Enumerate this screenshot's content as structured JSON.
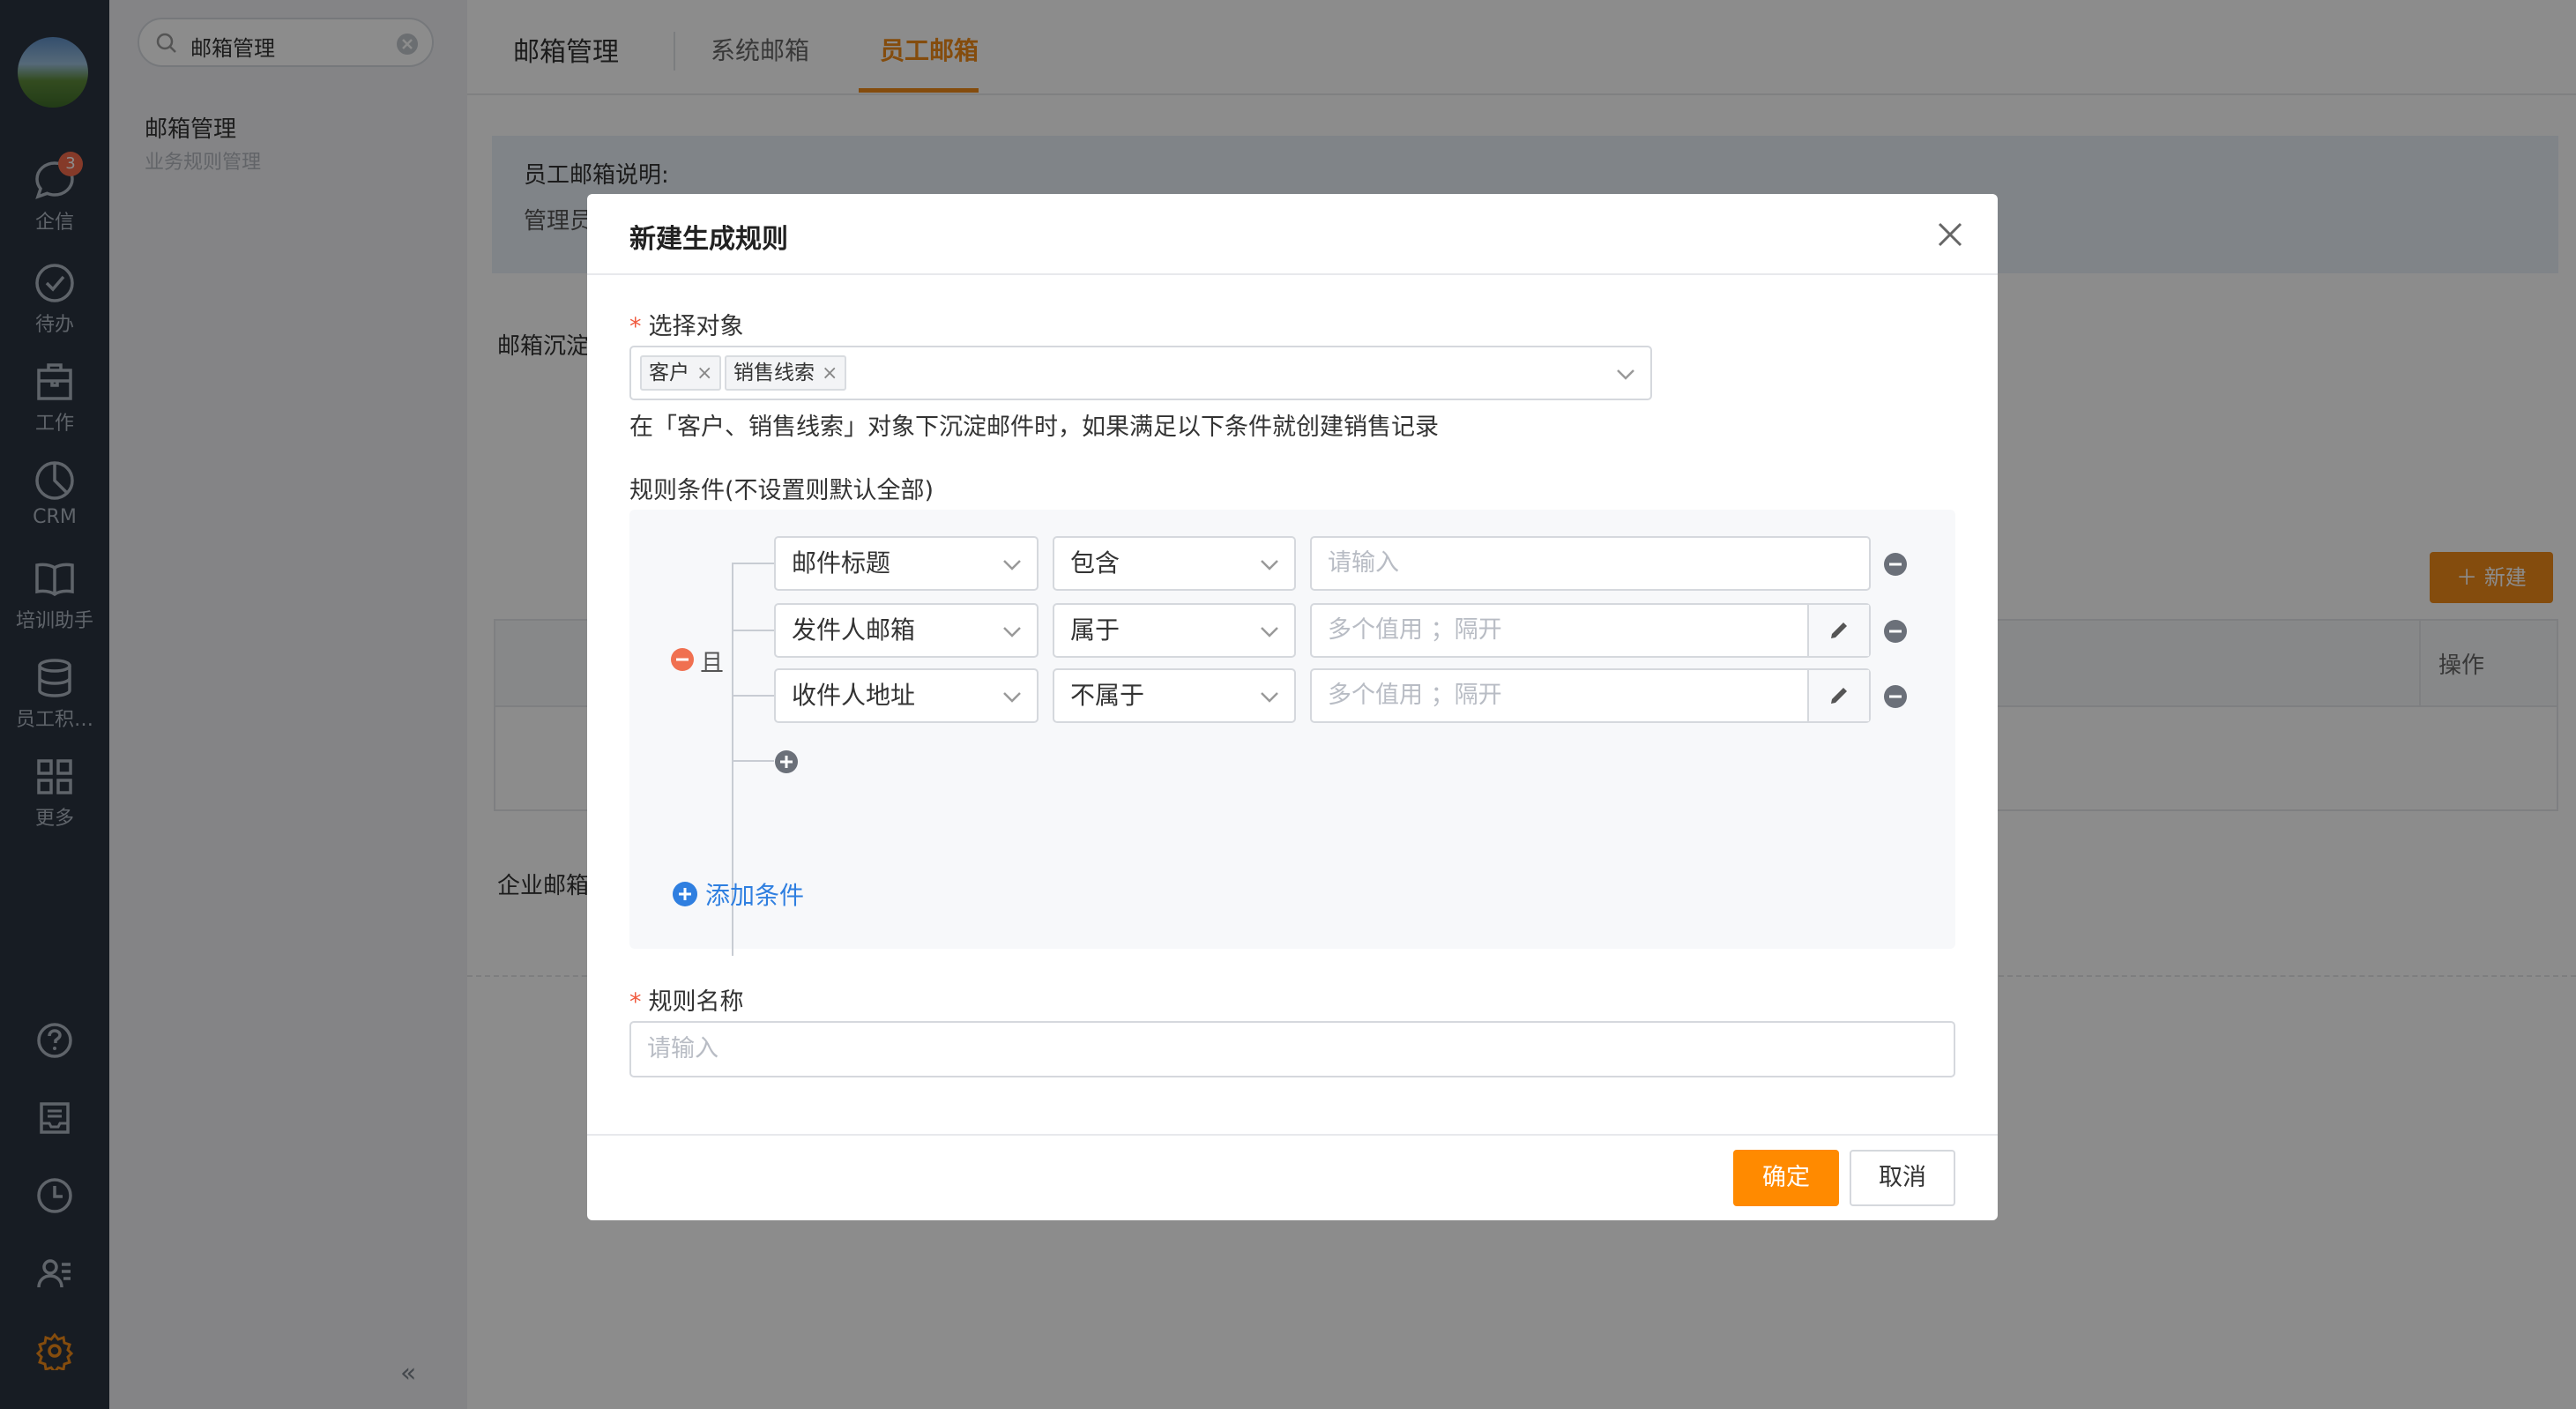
{
  "rail": {
    "items": [
      {
        "label": "企信",
        "icon": "chat-bubble-icon",
        "badge": "3"
      },
      {
        "label": "待办",
        "icon": "check-circle-icon"
      },
      {
        "label": "工作",
        "icon": "briefcase-icon"
      },
      {
        "label": "CRM",
        "icon": "pie-chart-icon"
      },
      {
        "label": "培训助手",
        "icon": "book-icon"
      },
      {
        "label": "员工积…",
        "icon": "database-icon"
      },
      {
        "label": "更多",
        "icon": "grid-icon"
      }
    ],
    "bottom_icons": [
      "help-icon",
      "inbox-icon",
      "clock-icon",
      "contacts-icon",
      "settings-gear-icon"
    ]
  },
  "sidebar": {
    "search_value": "邮箱管理",
    "item_title": "邮箱管理",
    "item_subtitle": "业务规则管理",
    "collapse_glyph": "«"
  },
  "tabs": [
    {
      "label": "邮箱管理"
    },
    {
      "label": "系统邮箱"
    },
    {
      "label": "员工邮箱",
      "active": true
    }
  ],
  "main": {
    "info_title": "员工邮箱说明:",
    "info_text": "管理员",
    "section1": "邮箱沉淀",
    "section2": "企业邮箱",
    "new_button": "新建",
    "table_op_header": "操作"
  },
  "modal": {
    "title": "新建生成规则",
    "object_label": "选择对象",
    "object_chips": [
      "客户",
      "销售线索"
    ],
    "hint": "在「客户、销售线索」对象下沉淀邮件时，如果满足以下条件就创建销售记录",
    "conditions_label": "规则条件(不设置则默认全部)",
    "logic_label": "且",
    "conditions": [
      {
        "field": "邮件标题",
        "op": "包含",
        "placeholder": "请输入",
        "has_edit": false
      },
      {
        "field": "发件人邮箱",
        "op": "属于",
        "placeholder": "多个值用 ；隔开",
        "has_edit": true
      },
      {
        "field": "收件人地址",
        "op": "不属于",
        "placeholder": "多个值用 ；隔开",
        "has_edit": true
      }
    ],
    "add_condition": "添加条件",
    "name_label": "规则名称",
    "name_placeholder": "请输入",
    "ok": "确定",
    "cancel": "取消"
  },
  "colors": {
    "accent": "#f08a19",
    "primary_button": "#ff8a00",
    "link": "#2f7fe0",
    "required": "#f05a3e",
    "rail": "#2b3340"
  }
}
